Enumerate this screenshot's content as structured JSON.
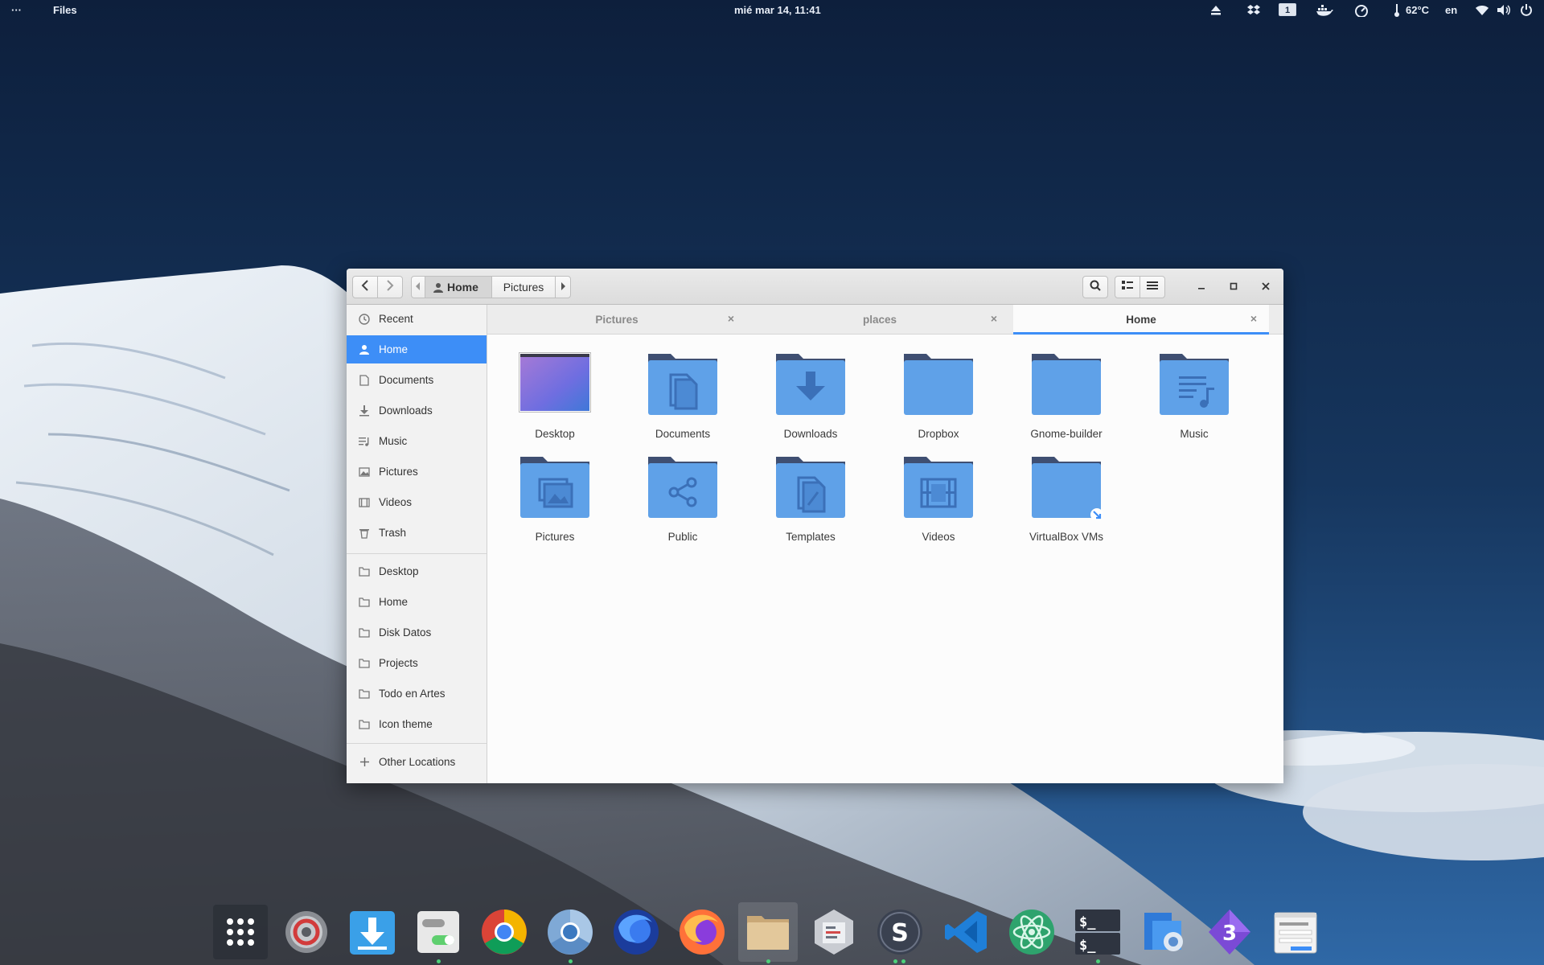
{
  "topbar": {
    "menu_dots": "···",
    "app_name": "Files",
    "clock": "mié mar 14, 11:41",
    "workspace": "1",
    "temperature": "62°C",
    "keyboard_layout": "en"
  },
  "window": {
    "breadcrumb": [
      "Home",
      "Pictures"
    ],
    "tabs": [
      {
        "label": "Pictures",
        "active": false
      },
      {
        "label": "places",
        "active": false
      },
      {
        "label": "Home",
        "active": true
      }
    ],
    "sidebar": {
      "places": [
        {
          "label": "Recent",
          "icon": "clock-icon"
        },
        {
          "label": "Home",
          "icon": "home-icon",
          "selected": true
        },
        {
          "label": "Documents",
          "icon": "document-icon"
        },
        {
          "label": "Downloads",
          "icon": "download-icon"
        },
        {
          "label": "Music",
          "icon": "music-icon"
        },
        {
          "label": "Pictures",
          "icon": "picture-icon"
        },
        {
          "label": "Videos",
          "icon": "video-icon"
        },
        {
          "label": "Trash",
          "icon": "trash-icon"
        }
      ],
      "bookmarks": [
        {
          "label": "Desktop",
          "icon": "folder-icon"
        },
        {
          "label": "Home",
          "icon": "folder-icon"
        },
        {
          "label": "Disk Datos",
          "icon": "folder-icon"
        },
        {
          "label": "Projects",
          "icon": "folder-icon"
        },
        {
          "label": "Todo en Artes",
          "icon": "folder-icon"
        },
        {
          "label": "Icon theme",
          "icon": "folder-icon"
        }
      ],
      "other_locations": "Other Locations"
    },
    "files": [
      {
        "name": "Desktop",
        "icon": "desktop-thumbnail"
      },
      {
        "name": "Documents",
        "icon": "folder-documents-icon"
      },
      {
        "name": "Downloads",
        "icon": "folder-downloads-icon"
      },
      {
        "name": "Dropbox",
        "icon": "folder-icon"
      },
      {
        "name": "Gnome-builder",
        "icon": "folder-icon"
      },
      {
        "name": "Music",
        "icon": "folder-music-icon"
      },
      {
        "name": "Pictures",
        "icon": "folder-pictures-icon"
      },
      {
        "name": "Public",
        "icon": "folder-public-icon"
      },
      {
        "name": "Templates",
        "icon": "folder-templates-icon"
      },
      {
        "name": "Videos",
        "icon": "folder-videos-icon"
      },
      {
        "name": "VirtualBox VMs",
        "icon": "folder-link-icon"
      }
    ]
  },
  "dock": {
    "apps": [
      {
        "name": "app-grid"
      },
      {
        "name": "settings"
      },
      {
        "name": "downloader"
      },
      {
        "name": "tweaks"
      },
      {
        "name": "chrome"
      },
      {
        "name": "chromium"
      },
      {
        "name": "firefox-nightly"
      },
      {
        "name": "firefox"
      },
      {
        "name": "files"
      },
      {
        "name": "gnome-builder"
      },
      {
        "name": "sublime-merge"
      },
      {
        "name": "vscode"
      },
      {
        "name": "atom"
      },
      {
        "name": "terminal"
      },
      {
        "name": "screenshot"
      },
      {
        "name": "blender-3"
      },
      {
        "name": "glade"
      }
    ]
  },
  "colors": {
    "accent": "#3d8ef7",
    "folder_body": "#5fa1e8",
    "folder_tab": "#3f4f72"
  }
}
